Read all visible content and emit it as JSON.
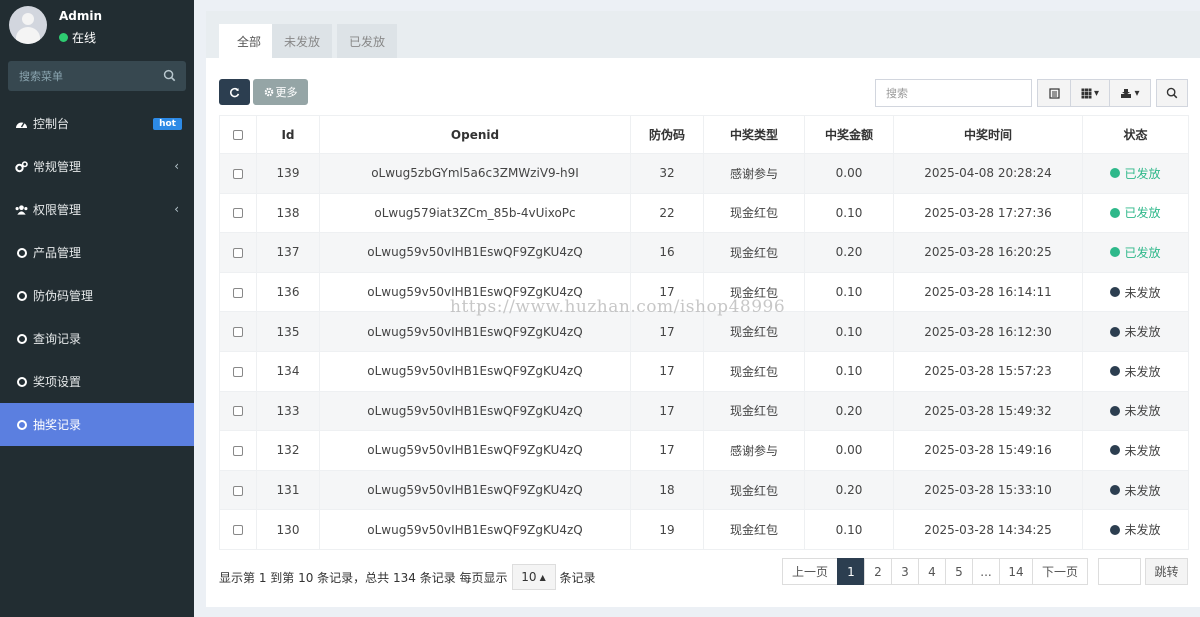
{
  "user": {
    "name": "Admin",
    "status": "在线"
  },
  "sidebar": {
    "search_placeholder": "搜索菜单",
    "items": [
      {
        "label": "控制台",
        "icon": "dashboard-icon",
        "badge": "hot"
      },
      {
        "label": "常规管理",
        "icon": "cogs-icon",
        "has_children": true
      },
      {
        "label": "权限管理",
        "icon": "group-icon",
        "has_children": true
      },
      {
        "label": "产品管理",
        "icon": "circle-icon"
      },
      {
        "label": "防伪码管理",
        "icon": "circle-icon"
      },
      {
        "label": "查询记录",
        "icon": "circle-icon"
      },
      {
        "label": "奖项设置",
        "icon": "circle-icon"
      },
      {
        "label": "抽奖记录",
        "icon": "circle-icon",
        "active": true
      }
    ]
  },
  "tabs": [
    {
      "label": "全部",
      "active": true
    },
    {
      "label": "未发放"
    },
    {
      "label": "已发放"
    }
  ],
  "toolbar": {
    "refresh_icon": "refresh-icon",
    "more_label": "更多",
    "search_placeholder": "搜索"
  },
  "table": {
    "columns": [
      "Id",
      "Openid",
      "防伪码",
      "中奖类型",
      "中奖金额",
      "中奖时间",
      "状态"
    ],
    "rows": [
      {
        "id": "139",
        "openid": "oLwug5zbGYml5a6c3ZMWziV9-h9I",
        "code": "32",
        "type": "感谢参与",
        "amount": "0.00",
        "time": "2025-04-08 20:28:24",
        "status": "已发放"
      },
      {
        "id": "138",
        "openid": "oLwug579iat3ZCm_85b-4vUixoPc",
        "code": "22",
        "type": "现金红包",
        "amount": "0.10",
        "time": "2025-03-28 17:27:36",
        "status": "已发放"
      },
      {
        "id": "137",
        "openid": "oLwug59v50vIHB1EswQF9ZgKU4zQ",
        "code": "16",
        "type": "现金红包",
        "amount": "0.20",
        "time": "2025-03-28 16:20:25",
        "status": "已发放"
      },
      {
        "id": "136",
        "openid": "oLwug59v50vIHB1EswQF9ZgKU4zQ",
        "code": "17",
        "type": "现金红包",
        "amount": "0.10",
        "time": "2025-03-28 16:14:11",
        "status": "未发放"
      },
      {
        "id": "135",
        "openid": "oLwug59v50vIHB1EswQF9ZgKU4zQ",
        "code": "17",
        "type": "现金红包",
        "amount": "0.10",
        "time": "2025-03-28 16:12:30",
        "status": "未发放"
      },
      {
        "id": "134",
        "openid": "oLwug59v50vIHB1EswQF9ZgKU4zQ",
        "code": "17",
        "type": "现金红包",
        "amount": "0.10",
        "time": "2025-03-28 15:57:23",
        "status": "未发放"
      },
      {
        "id": "133",
        "openid": "oLwug59v50vIHB1EswQF9ZgKU4zQ",
        "code": "17",
        "type": "现金红包",
        "amount": "0.20",
        "time": "2025-03-28 15:49:32",
        "status": "未发放"
      },
      {
        "id": "132",
        "openid": "oLwug59v50vIHB1EswQF9ZgKU4zQ",
        "code": "17",
        "type": "感谢参与",
        "amount": "0.00",
        "time": "2025-03-28 15:49:16",
        "status": "未发放"
      },
      {
        "id": "131",
        "openid": "oLwug59v50vIHB1EswQF9ZgKU4zQ",
        "code": "18",
        "type": "现金红包",
        "amount": "0.20",
        "time": "2025-03-28 15:33:10",
        "status": "未发放"
      },
      {
        "id": "130",
        "openid": "oLwug59v50vIHB1EswQF9ZgKU4zQ",
        "code": "19",
        "type": "现金红包",
        "amount": "0.10",
        "time": "2025-03-28 14:34:25",
        "status": "未发放"
      }
    ]
  },
  "footer": {
    "summary_before": "显示第 1 到第 10 条记录，总共 134 条记录 每页显示",
    "page_size": "10",
    "summary_after": "条记录"
  },
  "pagination": {
    "prev": "上一页",
    "pages": [
      "1",
      "2",
      "3",
      "4",
      "5",
      "...",
      "14"
    ],
    "current": "1",
    "next": "下一页",
    "jump": "跳转"
  },
  "colors": {
    "sidebar_bg": "#222d32",
    "active_menu": "#5b7fe0",
    "green_status": "#2eb88a",
    "dark_status": "#2c3e50",
    "primary_dark": "#2c3e50"
  },
  "watermark": "https://www.huzhan.com/ishop48996"
}
